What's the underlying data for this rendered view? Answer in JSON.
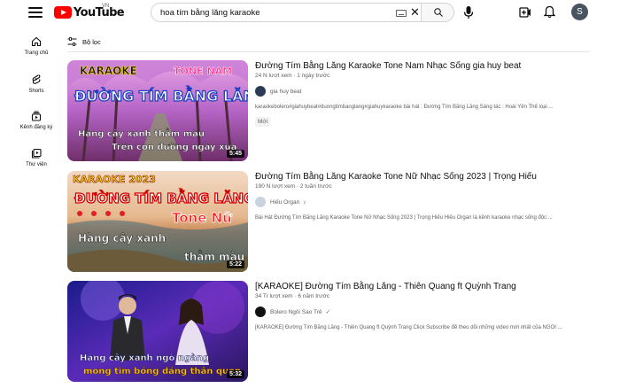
{
  "header": {
    "logo_text": "YouTube",
    "country_code": "VN",
    "search_value": "hoa tím bằng lăng karaoke",
    "avatar_letter": "S",
    "brand_color": "#ff0000"
  },
  "sidebar": {
    "items": [
      {
        "label": "Trang chủ",
        "icon": "home-icon"
      },
      {
        "label": "Shorts",
        "icon": "shorts-icon"
      },
      {
        "label": "Kênh đăng ký",
        "icon": "subscriptions-icon"
      },
      {
        "label": "Thư viện",
        "icon": "library-icon"
      }
    ]
  },
  "filter": {
    "label": "Bộ lọc",
    "icon": "filter-icon"
  },
  "results": [
    {
      "title": "Đường Tím Bằng Lăng Karaoke Tone Nam Nhạc Sống gia huy beat",
      "meta": "24 N lượt xem · 1 ngày trước",
      "channel": "gia huy beat",
      "description": "karaokebolero#giahuybeat#duongtimbanglang#giahuykaraoke bài hát : Đường Tím Bằng Lăng Sáng tác : Hoài Yên Thể loại ...",
      "badge": "Mới",
      "duration": "5:45",
      "thumb_text": {
        "top_left": "KARAOKE",
        "top_right": "TONE NAM",
        "headline": "ĐƯỜNG TÍM BẰNG LĂNG",
        "line1": "Hàng cây xanh thẳm màu",
        "line2": "Trên con đường ngày xưa"
      }
    },
    {
      "title": "Đường Tím Bằng Lăng Karaoke Tone Nữ Nhạc Sống 2023 | Trọng Hiếu",
      "meta": "190 N lượt xem · 2 tuần trước",
      "channel": "Hiếu Organ",
      "channel_badge": "♪",
      "description": "Bài Hát Đường Tím Bằng Lăng Karaoke Tone Nữ Nhạc Sống 2023 | Trọng Hiếu Hiếu Organ là kênh karaoke nhạc sống độc ...",
      "duration": "5:22",
      "thumb_text": {
        "top_left": "KARAOKE 2023",
        "headline": "ĐƯỜNG TÍM BẰNG LĂNG",
        "tone": "Tone Nữ",
        "line1": "Hàng cây xanh",
        "line2": "thẳm màu"
      }
    },
    {
      "title": "[KARAOKE] Đường Tím Bằng Lăng - Thiên Quang ft Quỳnh Trang",
      "meta": "34 Tr lượt xem · 6 năm trước",
      "channel": "Bolero Ngôi Sao Trẻ",
      "channel_badge": "✓",
      "description": "[KARAOKE] Đường Tím Bằng Lăng - Thiên Quang ft Quỳnh Trang Click Subscribe để theo dõi những video mới nhất của NGÔI ...",
      "duration": "5:32",
      "thumb_text": {
        "line1": "Hàng cây xanh ngờ ngàng",
        "line2": "mong tìm bóng dáng thân quen"
      }
    }
  ]
}
